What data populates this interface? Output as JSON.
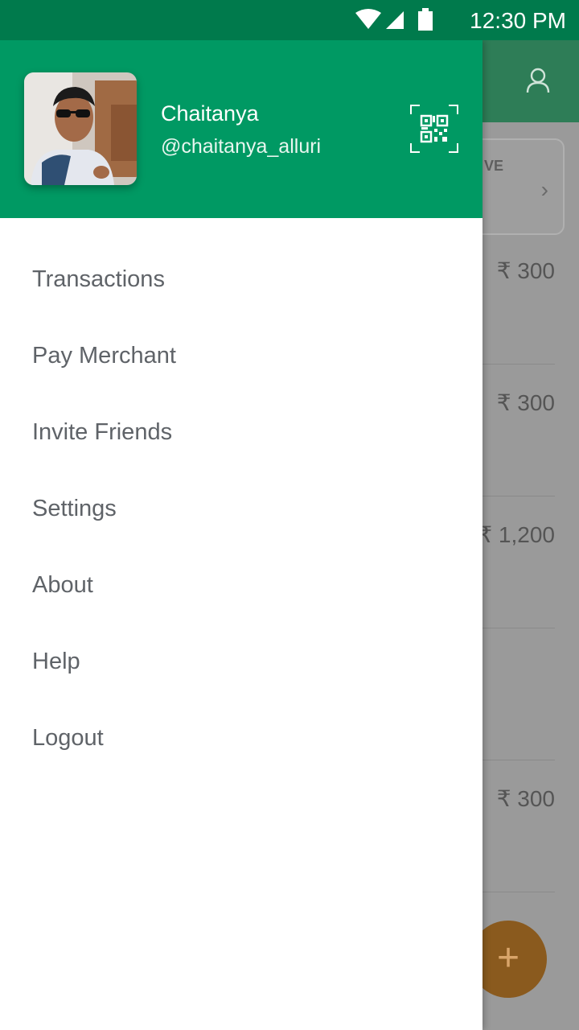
{
  "status_bar": {
    "time": "12:30 PM"
  },
  "drawer": {
    "user": {
      "name": "Chaitanya",
      "handle": "@chaitanya_alluri"
    },
    "menu": [
      {
        "label": "Transactions"
      },
      {
        "label": "Pay Merchant"
      },
      {
        "label": "Invite Friends"
      },
      {
        "label": "Settings"
      },
      {
        "label": "About"
      },
      {
        "label": "Help"
      },
      {
        "label": "Logout"
      }
    ]
  },
  "background": {
    "card_label": "VE",
    "amounts": [
      "₹ 300",
      "₹ 300",
      "₹ 1,200",
      "₹ 300"
    ],
    "fab_label": "+"
  },
  "colors": {
    "status_bar": "#007a4c",
    "drawer_header": "#009963",
    "menu_text": "#5f6368",
    "fab": "#e38b2c"
  }
}
